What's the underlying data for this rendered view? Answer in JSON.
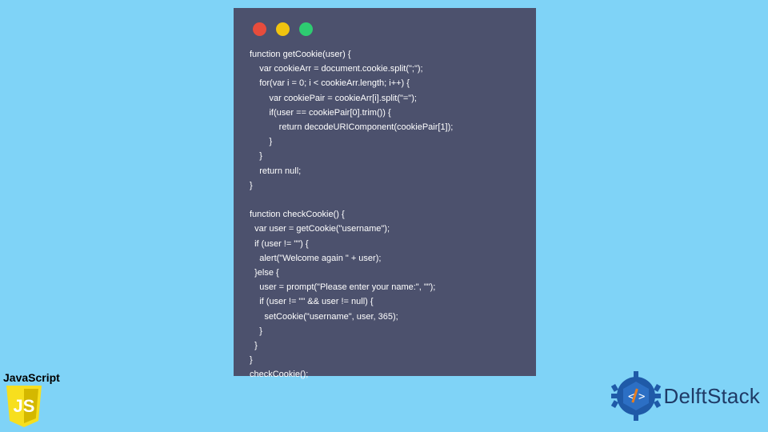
{
  "window": {
    "traffic_lights": [
      "red",
      "yellow",
      "green"
    ]
  },
  "code": "function getCookie(user) {\n    var cookieArr = document.cookie.split(\";\");\n    for(var i = 0; i < cookieArr.length; i++) {\n        var cookiePair = cookieArr[i].split(\"=\");\n        if(user == cookiePair[0].trim()) {\n            return decodeURIComponent(cookiePair[1]);\n        }\n    }\n    return null;\n}\n\nfunction checkCookie() {\n  var user = getCookie(\"username\");\n  if (user != \"\") {\n    alert(\"Welcome again \" + user);\n  }else {\n    user = prompt(\"Please enter your name:\", \"\");\n    if (user != \"\" && user != null) {\n      setCookie(\"username\", user, 365);\n    }\n  }\n}\ncheckCookie();",
  "js_badge": {
    "label": "JavaScript",
    "shield_text": "JS",
    "shield_fill": "#f7df1e",
    "shield_edge": "#d4b800"
  },
  "delft": {
    "text": "DelftStack",
    "emblem_color": "#1f5aa8",
    "accent_color": "#e67e22"
  }
}
